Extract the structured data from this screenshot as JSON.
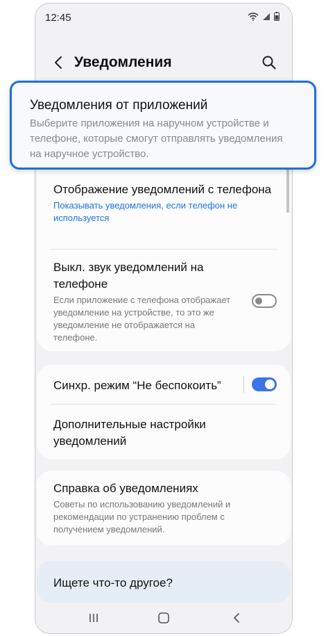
{
  "status_bar": {
    "time": "12:45"
  },
  "app_bar": {
    "title": "Уведомления"
  },
  "highlight": {
    "title": "Уведомления от приложений",
    "description": "Выберите приложения на наручном устройстве и телефоне, которые смогут отправлять уведомления на наручное устройство."
  },
  "settings": {
    "show_phone_notifications": {
      "title": "Отображение уведомлений с телефона",
      "subtitle": "Показывать уведомления, если телефон не используется"
    },
    "mute_phone": {
      "title": "Выкл. звук уведомлений на телефоне",
      "subtitle": "Если приложение с телефона отображает уведомление на устройстве, то это же уведомление не отображается на телефоне.",
      "enabled": false
    },
    "sync_dnd": {
      "title": "Синхр. режим “Не беспокоить”",
      "enabled": true
    },
    "advanced": {
      "title": "Дополнительные настройки уведомлений"
    },
    "help": {
      "title": "Справка об уведомлениях",
      "subtitle": "Советы по использованию уведомлений и рекомендации по устранению проблем с получением уведомлений."
    }
  },
  "looking_for": {
    "label": "Ищете что-то другое?"
  },
  "colors": {
    "accent": "#1e6fd9",
    "toggle_on": "#3b74e8",
    "link": "#1a73e8"
  },
  "icons": [
    "wifi-icon",
    "signal-icon",
    "battery-icon",
    "back-arrow-icon",
    "search-icon",
    "recents-icon",
    "home-icon",
    "nav-back-icon"
  ]
}
